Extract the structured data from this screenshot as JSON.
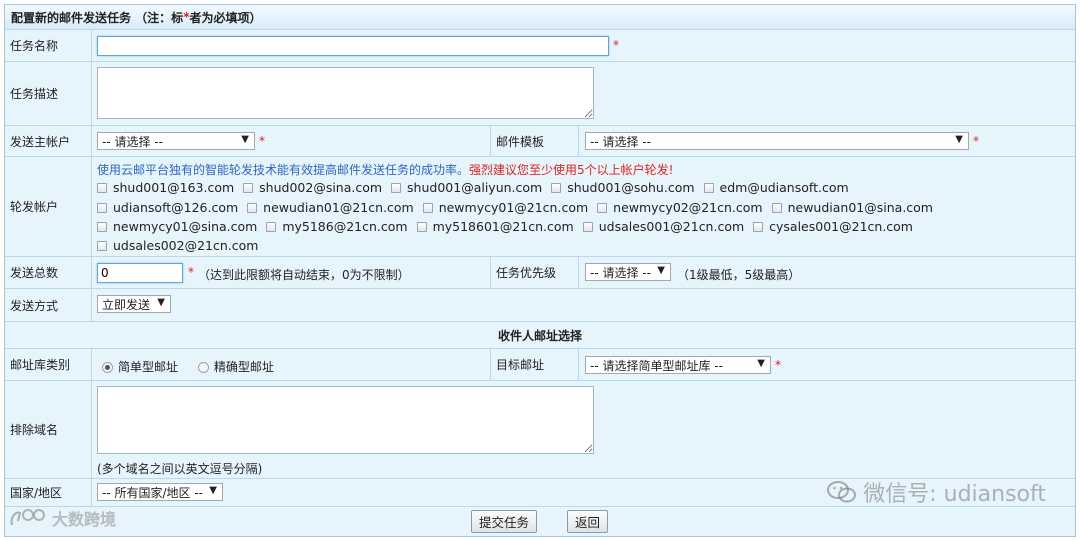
{
  "header": {
    "title_prefix": "配置新的邮件发送任务 （注：标",
    "title_star": "*",
    "title_suffix": "者为必填项）"
  },
  "form": {
    "task_name": {
      "label": "任务名称",
      "value": "",
      "required": "*"
    },
    "task_desc": {
      "label": "任务描述",
      "value": ""
    },
    "sender_account": {
      "label": "发送主帐户",
      "selected": "-- 请选择 --",
      "required": "*"
    },
    "mail_template": {
      "label": "邮件模板",
      "selected": "-- 请选择 --",
      "required": "*"
    },
    "rotation": {
      "label": "轮发帐户",
      "hint_blue": "使用云邮平台独有的智能轮发技术能有效提高邮件发送任务的成功率。",
      "hint_red": "强烈建议您至少使用5个以上帐户轮发!",
      "accounts": [
        "shud001@163.com",
        "shud002@sina.com",
        "shud001@aliyun.com",
        "shud001@sohu.com",
        "edm@udiansoft.com",
        "udiansoft@126.com",
        "newudian01@21cn.com",
        "newmycy01@21cn.com",
        "newmycy02@21cn.com",
        "newudian01@sina.com",
        "newmycy01@sina.com",
        "my5186@21cn.com",
        "my518601@21cn.com",
        "udsales001@21cn.com",
        "cysales001@21cn.com",
        "udsales002@21cn.com"
      ]
    },
    "total_send": {
      "label": "发送总数",
      "value": "0",
      "required": "*",
      "note": "（达到此限额将自动结束，0为不限制）"
    },
    "priority": {
      "label": "任务优先级",
      "selected": "-- 请选择 --",
      "note": "（1级最低，5级最高）"
    },
    "send_mode": {
      "label": "发送方式",
      "selected": "立即发送"
    },
    "recipient_section": {
      "title": "收件人邮址选择"
    },
    "library_type": {
      "label": "邮址库类别",
      "options": [
        "简单型邮址",
        "精确型邮址"
      ],
      "selected_index": 0
    },
    "target_mail": {
      "label": "目标邮址",
      "selected": "-- 请选择简单型邮址库 --",
      "required": "*"
    },
    "exclude_domain": {
      "label": "排除域名",
      "value": "",
      "note": "(多个域名之间以英文逗号分隔)"
    },
    "country": {
      "label": "国家/地区",
      "selected": "-- 所有国家/地区 --"
    }
  },
  "actions": {
    "submit": "提交任务",
    "back": "返回"
  },
  "watermarks": {
    "wechat": "微信号: udiansoft",
    "logo": "大数跨境"
  },
  "icons": {
    "dropdown": "triangle-down",
    "wechat": "wechat-logo",
    "logo": "dsk-logo"
  }
}
